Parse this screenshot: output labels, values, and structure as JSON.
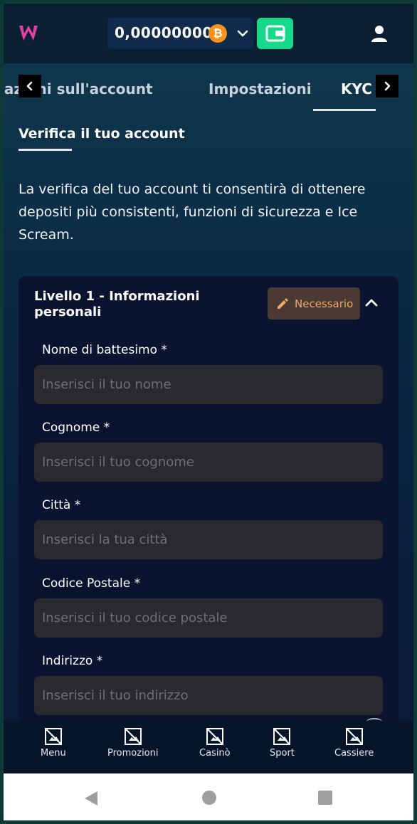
{
  "header": {
    "balance": "0,00000000",
    "currency_icon": "bitcoin-icon",
    "currency_symbol": "₿",
    "accent_color": "#16d98a",
    "logo_color": "#e040a0"
  },
  "tabs": {
    "items": [
      {
        "label": "Informazioni sull'account"
      },
      {
        "label": "Impostazioni"
      },
      {
        "label": "KYC"
      }
    ],
    "active_index": 2
  },
  "section": {
    "title": "Verifica il tuo account",
    "description": "La verifica del tuo account ti consentirà di ottenere depositi più consistenti, funzioni di sicurezza e Ice Scream."
  },
  "card": {
    "title": "Livello 1 - Informazioni personali",
    "badge_label": "Necessario",
    "badge_color": "#f2a66a",
    "fields": [
      {
        "label": "Nome di battesimo *",
        "placeholder": "Inserisci il tuo nome",
        "value": ""
      },
      {
        "label": "Cognome *",
        "placeholder": "Inserisci il tuo cognome",
        "value": ""
      },
      {
        "label": "Città *",
        "placeholder": "Inserisci la tua città",
        "value": ""
      },
      {
        "label": "Codice Postale *",
        "placeholder": "Inserisci il tuo codice postale",
        "value": ""
      },
      {
        "label": "Indirizzo *",
        "placeholder": "Inserisci il tuo indirizzo",
        "value": ""
      }
    ]
  },
  "bottom_nav": {
    "items": [
      {
        "label": "Menu",
        "icon": "broken-image-icon"
      },
      {
        "label": "Promozioni",
        "icon": "broken-image-icon"
      },
      {
        "label": "Casinò",
        "icon": "broken-image-icon"
      },
      {
        "label": "Sport",
        "icon": "broken-image-icon"
      },
      {
        "label": "Cassiere",
        "icon": "broken-image-icon"
      }
    ]
  }
}
